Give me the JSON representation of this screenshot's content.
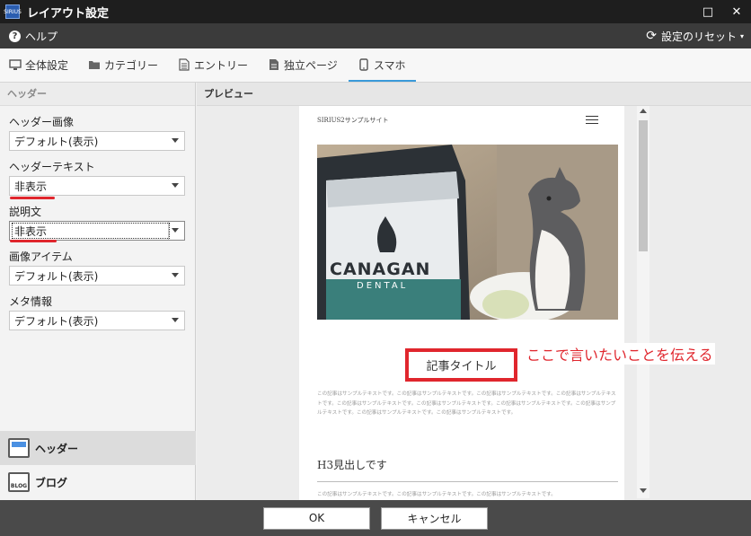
{
  "window": {
    "title": "レイアウト設定",
    "icon_text": "SIRIUS",
    "maximize_glyph": "□",
    "close_glyph": "✕"
  },
  "menubar": {
    "help_icon": "?",
    "help_label": "ヘルプ",
    "reset_label": "設定のリセット",
    "reset_icon": "⟳",
    "caret": "▾"
  },
  "tabs": [
    {
      "icon": "monitor-icon",
      "label": "全体設定"
    },
    {
      "icon": "folder-icon",
      "label": "カテゴリー"
    },
    {
      "icon": "document-icon",
      "label": "エントリー"
    },
    {
      "icon": "page-icon",
      "label": "独立ページ"
    },
    {
      "icon": "smartphone-icon",
      "label": "スマホ",
      "active": true
    }
  ],
  "left_panel": {
    "title": "ヘッダー",
    "fields": [
      {
        "label": "ヘッダー画像",
        "value": "デフォルト(表示)"
      },
      {
        "label": "ヘッダーテキスト",
        "value": "非表示"
      },
      {
        "label": "説明文",
        "value": "非表示"
      },
      {
        "label": "画像アイテム",
        "value": "デフォルト(表示)"
      },
      {
        "label": "メタ情報",
        "value": "デフォルト(表示)"
      }
    ],
    "nav": [
      {
        "label": "ヘッダー",
        "active": true
      },
      {
        "label": "ブログ",
        "icon_text": "BLOG"
      }
    ]
  },
  "preview": {
    "title": "プレビュー",
    "site_name": "SIRIUS2サンプルサイト",
    "article_title": "記事タイトル",
    "body_text": "この記事はサンプルテキストです。この記事はサンプルテキストです。この記事はサンプルテキストです。この記事はサンプルテキストです。この記事はサンプルテキストです。この記事はサンプルテキストです。この記事はサンプルテキストです。この記事はサンプルテキストです。この記事はサンプルテキストです。この記事はサンプルテキストです。",
    "h3": "H3見出しです",
    "body_text2": "この記事はサンプルテキストです。この記事はサンプルテキストです。この記事はサンプルテキストです。",
    "photo_text": "CANAGAN",
    "photo_text2": "DENTAL",
    "annotation": "ここで言いたいことを伝える"
  },
  "footer": {
    "ok_label": "OK",
    "cancel_label": "キャンセル"
  },
  "colors": {
    "accent_red": "#e0262d",
    "tab_active": "#3a9ad9",
    "titlebar": "#1e1e1e",
    "menubar": "#3b3b3b",
    "footer": "#4a4a4a"
  }
}
